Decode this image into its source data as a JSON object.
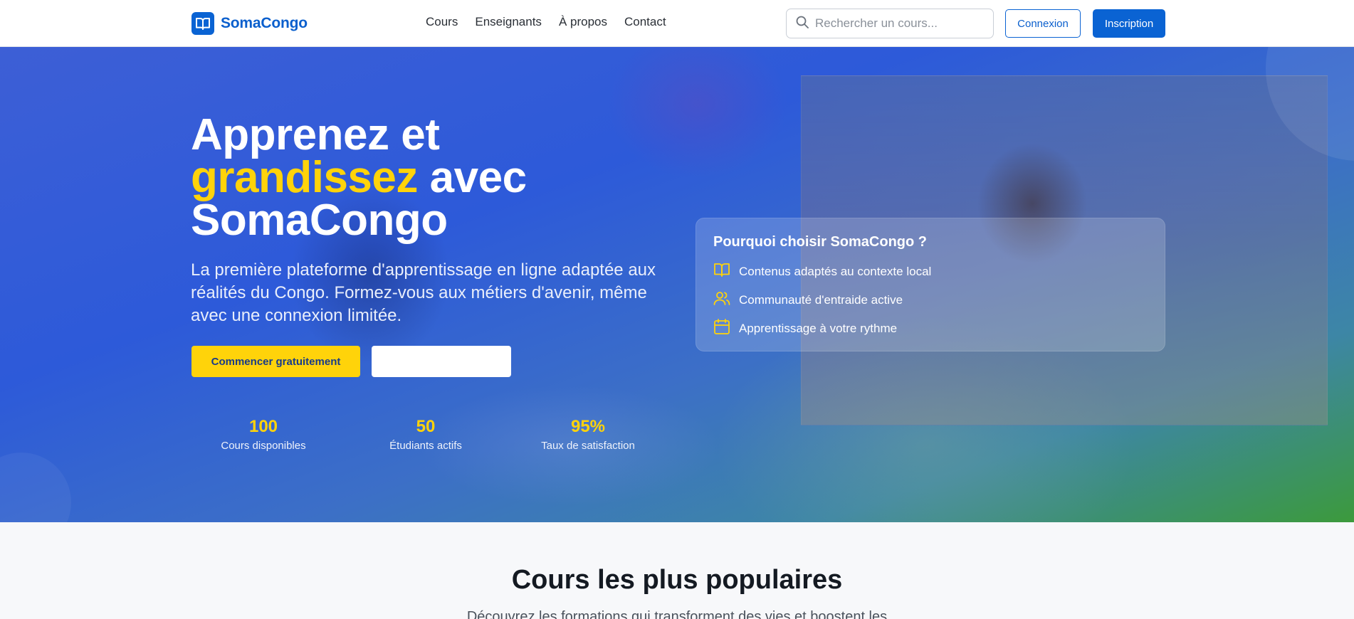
{
  "header": {
    "logo_text": "SomaCongo",
    "nav": [
      "Cours",
      "Enseignants",
      "À propos",
      "Contact"
    ],
    "search_placeholder": "Rechercher un cours...",
    "login_label": "Connexion",
    "signup_label": "Inscription"
  },
  "hero": {
    "headline_line1": "Apprenez et",
    "headline_accent": "grandissez",
    "headline_rest": " avec",
    "headline_line3": "SomaCongo",
    "subtitle": "La première plateforme d'apprentissage en ligne adaptée aux réalités du Congo. Formez-vous aux métiers d'avenir, même avec une connexion limitée.",
    "start_button": "Commencer gratuitement",
    "secondary_button": "",
    "stats": [
      {
        "value": "100",
        "label": "Cours disponibles"
      },
      {
        "value": "50",
        "label": "Étudiants actifs"
      },
      {
        "value": "95%",
        "label": "Taux de satisfaction"
      }
    ]
  },
  "why_card": {
    "title": "Pourquoi choisir SomaCongo ?",
    "items": [
      {
        "icon": "book-open-icon",
        "label": "Contenus adaptés au contexte local"
      },
      {
        "icon": "users-icon",
        "label": "Communauté d'entraide active"
      },
      {
        "icon": "calendar-icon",
        "label": "Apprentissage à votre rythme"
      }
    ]
  },
  "popular": {
    "title": "Cours les plus populaires",
    "subtitle": "Découvrez les formations qui transforment des vies et boostent les"
  },
  "colors": {
    "brand_blue": "#0a63d3",
    "accent_yellow": "#ffd30a"
  }
}
